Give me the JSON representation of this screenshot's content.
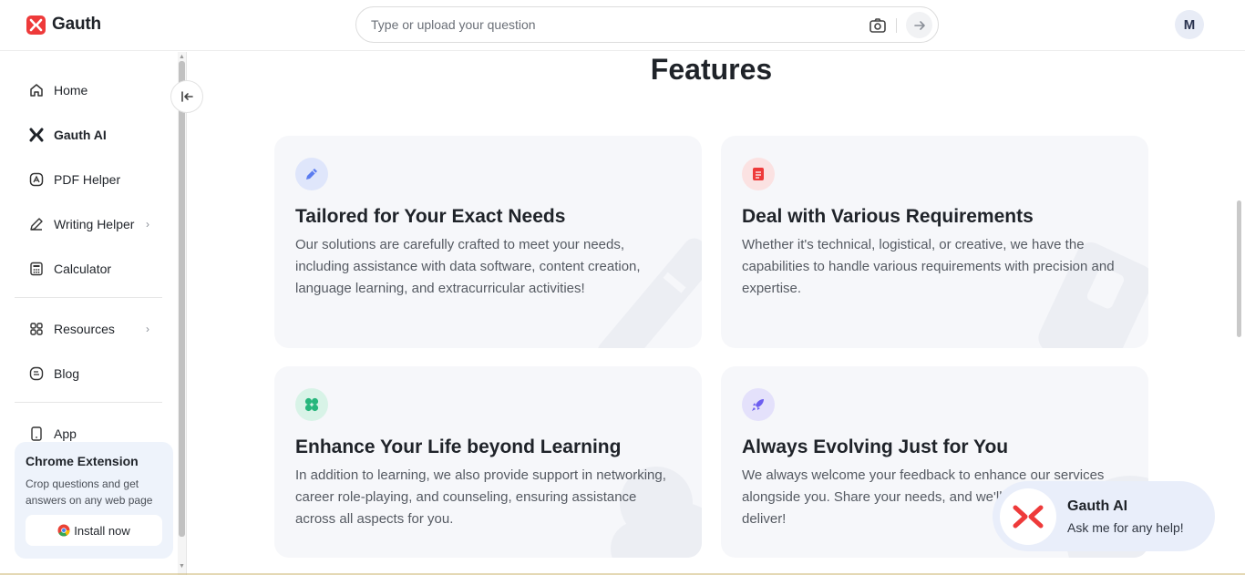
{
  "header": {
    "brand": "Gauth",
    "search_placeholder": "Type or upload your question",
    "avatar_initial": "M"
  },
  "sidebar": {
    "items": [
      {
        "label": "Home",
        "icon": "home-icon"
      },
      {
        "label": "Gauth AI",
        "icon": "gauth-ai-icon"
      },
      {
        "label": "PDF Helper",
        "icon": "pdf-icon"
      },
      {
        "label": "Writing Helper",
        "icon": "pen-icon",
        "has_submenu": true
      },
      {
        "label": "Calculator",
        "icon": "calculator-icon"
      },
      {
        "label": "Resources",
        "icon": "grid-icon",
        "has_submenu": true
      },
      {
        "label": "Blog",
        "icon": "blog-icon"
      },
      {
        "label": "App",
        "icon": "phone-icon"
      }
    ],
    "chrome_extension": {
      "title": "Chrome Extension",
      "description": "Crop questions and get answers on any web page",
      "install_label": "Install now"
    }
  },
  "main": {
    "section_title": "Features",
    "cards": [
      {
        "title": "Tailored for Your Exact Needs",
        "description": "Our solutions are carefully crafted to meet your needs, including assistance with data software, content creation, language learning, and extracurricular activities!",
        "icon": "pencil-icon",
        "icon_color": "#5b7cf0"
      },
      {
        "title": "Deal with Various Requirements",
        "description": "Whether it's technical, logistical, or creative, we have the capabilities to handle various requirements with precision and expertise.",
        "icon": "document-icon",
        "icon_color": "#ee3a3a"
      },
      {
        "title": "Enhance Your Life beyond Learning",
        "description": "In addition to learning, we also provide support in networking, career role-playing, and counseling, ensuring assistance across all aspects for you.",
        "icon": "clover-icon",
        "icon_color": "#27b67c"
      },
      {
        "title": "Always Evolving Just for You",
        "description": "We always welcome your feedback to enhance our services alongside you. Share your needs, and we'll make sure to deliver!",
        "icon": "rocket-icon",
        "icon_color": "#6d5ef0"
      }
    ]
  },
  "chat_widget": {
    "title": "Gauth AI",
    "subtitle": "Ask me for any help!"
  }
}
